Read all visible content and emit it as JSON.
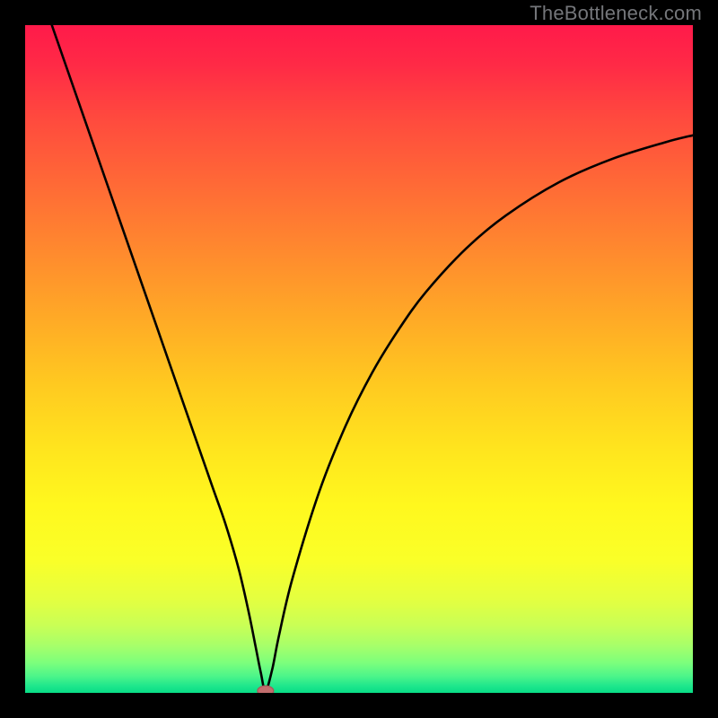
{
  "watermark": "TheBottleneck.com",
  "colors": {
    "frame": "#000000",
    "watermark": "#74767a",
    "curve": "#000000",
    "marker_fill": "#c26e6e",
    "marker_stroke": "#a95a5a"
  },
  "gradient_stops": [
    {
      "offset": 0.0,
      "color": "#ff1a4a"
    },
    {
      "offset": 0.06,
      "color": "#ff2a46"
    },
    {
      "offset": 0.14,
      "color": "#ff4a3e"
    },
    {
      "offset": 0.24,
      "color": "#ff6a36"
    },
    {
      "offset": 0.34,
      "color": "#ff8a2e"
    },
    {
      "offset": 0.44,
      "color": "#ffaa26"
    },
    {
      "offset": 0.54,
      "color": "#ffca20"
    },
    {
      "offset": 0.64,
      "color": "#ffe61e"
    },
    {
      "offset": 0.72,
      "color": "#fff81e"
    },
    {
      "offset": 0.8,
      "color": "#faff28"
    },
    {
      "offset": 0.86,
      "color": "#e4ff40"
    },
    {
      "offset": 0.9,
      "color": "#c8ff56"
    },
    {
      "offset": 0.93,
      "color": "#a6ff6a"
    },
    {
      "offset": 0.955,
      "color": "#7cff7c"
    },
    {
      "offset": 0.975,
      "color": "#4cf58a"
    },
    {
      "offset": 0.99,
      "color": "#1ee68c"
    },
    {
      "offset": 1.0,
      "color": "#08dd86"
    }
  ],
  "chart_data": {
    "type": "line",
    "title": "",
    "xlabel": "",
    "ylabel": "",
    "xlim": [
      0,
      100
    ],
    "ylim": [
      0,
      100
    ],
    "grid": false,
    "legend": false,
    "series": [
      {
        "name": "bottleneck-curve",
        "x": [
          4,
          8,
          12,
          16,
          20,
          24,
          28,
          30,
          32,
          33.5,
          34.5,
          35.3,
          36,
          37,
          38,
          40,
          44,
          48,
          52,
          56,
          60,
          66,
          72,
          80,
          88,
          96,
          100
        ],
        "y": [
          100,
          88.5,
          77,
          65.5,
          54,
          42.5,
          31,
          25.3,
          18.5,
          12,
          7,
          3,
          0.3,
          3.5,
          8.5,
          17,
          30,
          40,
          48,
          54.5,
          60,
          66.5,
          71.5,
          76.5,
          80,
          82.5,
          83.5
        ]
      }
    ],
    "marker": {
      "x": 36,
      "y": 0.3,
      "rx": 1.2,
      "ry": 0.75
    }
  }
}
